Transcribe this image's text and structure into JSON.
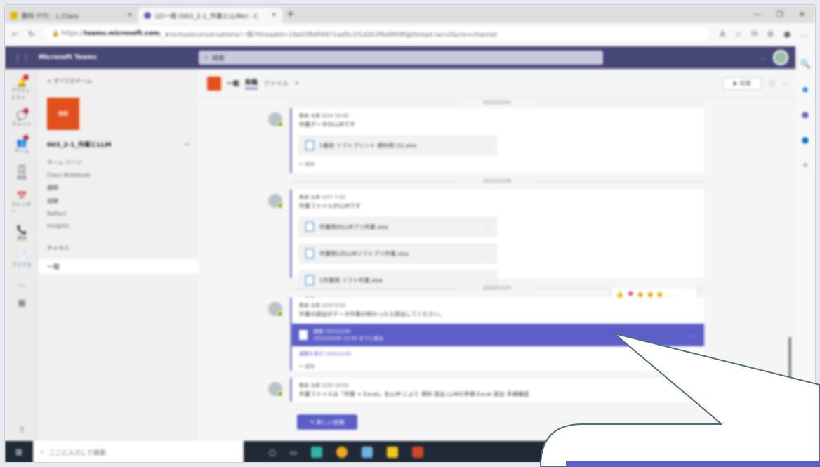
{
  "browser": {
    "tabs": [
      {
        "label": "教科 ITTC - L.Class"
      },
      {
        "label": "(2)一般 (003_2-1_作業とLLMe) - C"
      }
    ],
    "url_host": "teams.microsoft.com",
    "url_rest": "/_#/school/conversations/一般?threadId=19a03fb6f4971ad5c1f1d2b3f6d9f09f@thread.tacv2&ctx=channel"
  },
  "teams": {
    "app_name": "Microsoft Teams",
    "search_placeholder": "検索"
  },
  "rail": [
    {
      "label": "アクティビティ"
    },
    {
      "label": "チャット"
    },
    {
      "label": "チーム"
    },
    {
      "label": "課題"
    },
    {
      "label": "カレンダー"
    },
    {
      "label": "通話"
    },
    {
      "label": "ファイル"
    }
  ],
  "team_panel": {
    "back_label": "< すべてのチーム",
    "logo_text": "00",
    "team_name": "003_2-1_作業とLLM",
    "nav": [
      "ホーム ページ",
      "Class Notebook",
      "課題",
      "成績",
      "Reflect",
      "Insights"
    ],
    "section_label": "チャネル",
    "channel": "一般"
  },
  "channel_header": {
    "name": "一般",
    "tab_posts": "投稿",
    "tab_files": "ファイル",
    "meet_label": "会議"
  },
  "feed": {
    "date1": "2022/02/01",
    "msg1": {
      "meta": "教員 太郎 2/14 10:02",
      "text": "作業データのLLMです",
      "file1": "1番目 ソフトプリント 資料例 (1).xlsx"
    },
    "date2": "2022/02/08",
    "msg2": {
      "meta": "教員 太郎 2/17 7:02",
      "text": "作業ファイルがLLMです",
      "file1": "作業例のLLMプリ作業.xlsx",
      "file2": "作業例1のLLMソフトプリ作業.xlsx",
      "file3": "1作業例 ソフト作業.xlsx"
    },
    "date3": "2022/02/09",
    "msg3": {
      "meta": "教員 太郎 2/19 9:02",
      "text": "作業の提出がデータ作業が終わったら提出してください。",
      "card_title": "課題 (2022/2/9)",
      "card_sub": "2022/02/09 23:59 までに提出",
      "link": "課題を表示 (2022/2/9)"
    },
    "msg4": {
      "meta": "教員 太郎 2/20 10:02",
      "text": "作業ファイルは「作業 + Excel」をLLM  により 資料 提出 LLMの手順 Excel 提出 手順確認"
    },
    "reply_label": "↩ 返信",
    "new_post": "新しい投稿"
  },
  "taskbar": {
    "search_placeholder": "ここに入力して検索"
  },
  "colors": {
    "teams_purple": "#464775",
    "accent": "#5b5fc7",
    "team_orange": "#e2501e"
  }
}
